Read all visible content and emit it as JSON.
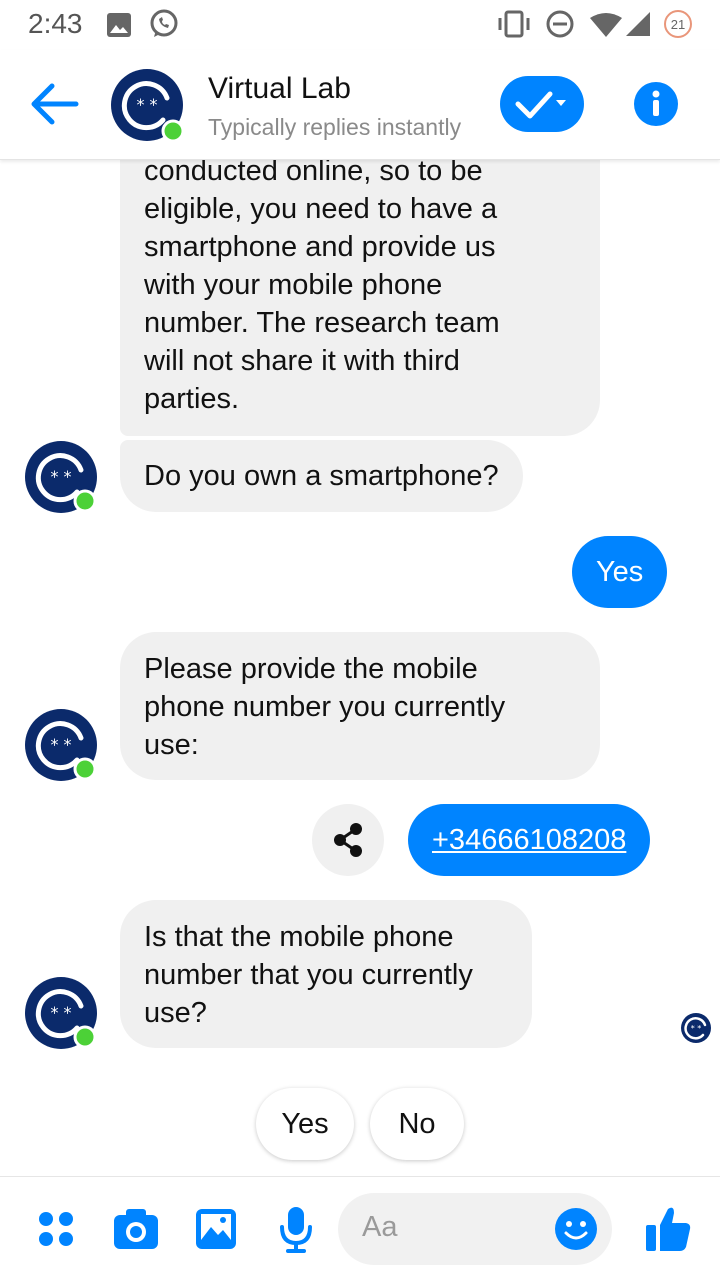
{
  "status": {
    "time": "2:43",
    "battery": "21"
  },
  "header": {
    "title": "Virtual Lab",
    "subtitle": "Typically replies instantly"
  },
  "messages": {
    "m1": [
      "conducted online, so to be",
      "eligible, you need to have a",
      "smartphone and provide us",
      "with your mobile phone",
      "number. The research team",
      "will not share it with third",
      "parties."
    ],
    "m2": "Do you own a smartphone?",
    "m3": "Yes",
    "m4": [
      "Please provide the mobile",
      "phone number you currently",
      "use:"
    ],
    "m5": "+34666108208",
    "m6": [
      "Is that the mobile phone",
      "number that you currently",
      "use?"
    ]
  },
  "quick_replies": {
    "yes": "Yes",
    "no": "No"
  },
  "composer": {
    "placeholder": "Aa"
  },
  "colors": {
    "accent": "#0084ff",
    "bubble_in": "#f0f0f0",
    "avatar": "#0b2a6b",
    "online": "#4cd137"
  }
}
